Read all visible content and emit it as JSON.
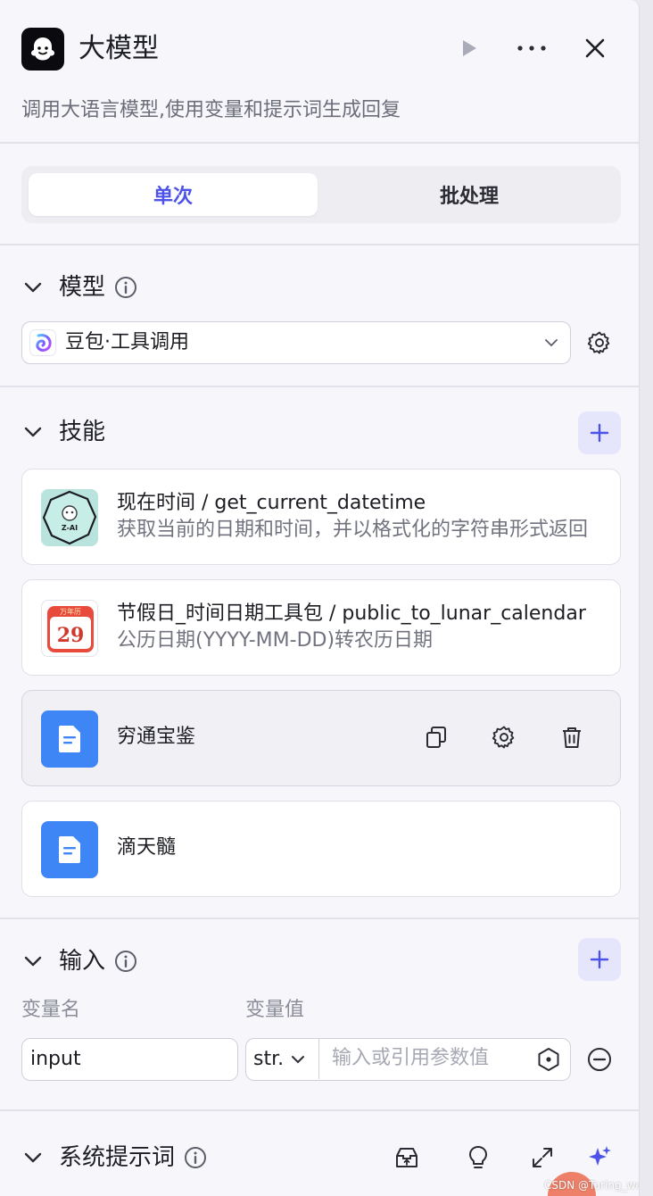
{
  "header": {
    "title": "大模型",
    "subtitle": "调用大语言模型,使用变量和提示词生成回复"
  },
  "mode_tabs": {
    "single": "单次",
    "batch": "批处理",
    "active": "单次"
  },
  "model_section": {
    "title": "模型",
    "selected_model": "豆包·工具调用"
  },
  "skills_section": {
    "title": "技能",
    "items": [
      {
        "title": "现在时间 / get_current_datetime",
        "desc": "获取当前的日期和时间，并以格式化的字符串形式返回",
        "icon": "z-ai-bot-icon",
        "icon_label": "Z-AI"
      },
      {
        "title": "节假日_时间日期工具包 / public_to_lunar_calendar",
        "desc": "公历日期(YYYY-MM-DD)转农历日期",
        "icon": "calendar-icon",
        "icon_top": "万年历",
        "icon_day": "29"
      },
      {
        "title": "穷通宝鉴",
        "desc": "",
        "icon": "document-icon"
      },
      {
        "title": "滴天髓",
        "desc": "",
        "icon": "document-icon"
      }
    ]
  },
  "input_section": {
    "title": "输入",
    "col_name": "变量名",
    "col_value": "变量值",
    "rows": [
      {
        "name": "input",
        "type": "str.",
        "value_placeholder": "输入或引用参数值"
      }
    ]
  },
  "system_prompt_section": {
    "title": "系统提示词"
  },
  "watermark": "CSDN @Turing_well",
  "colors": {
    "accent": "#4d53e8",
    "doc_icon": "#3e86f6",
    "panel_bg": "#f7f7fb"
  }
}
